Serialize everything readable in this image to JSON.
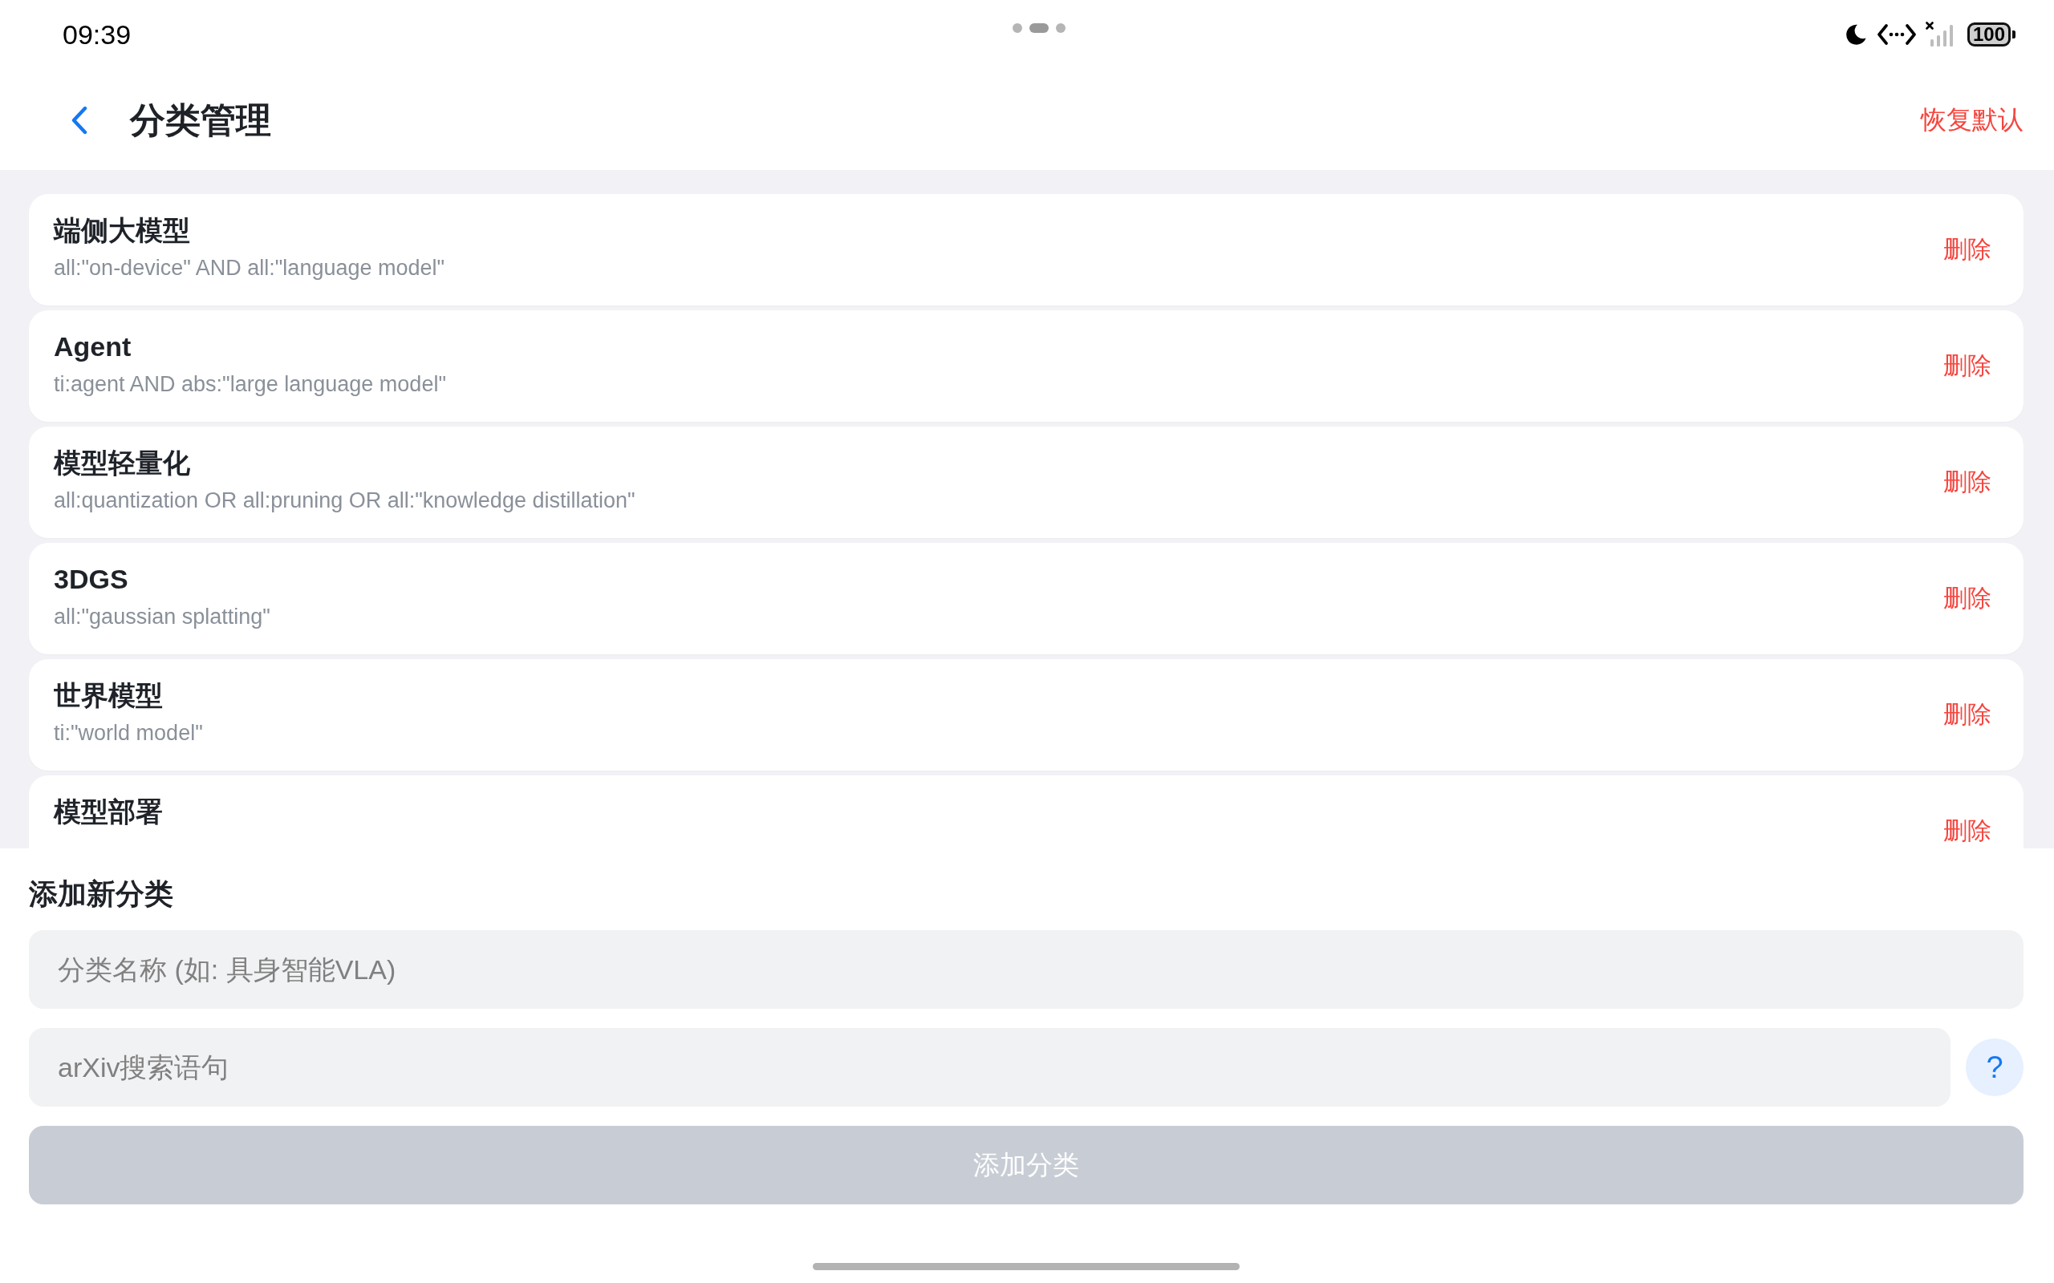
{
  "status_bar": {
    "time": "09:39",
    "battery": "100"
  },
  "header": {
    "title": "分类管理",
    "action": "恢复默认"
  },
  "categories": [
    {
      "name": "端侧大模型",
      "query": "all:\"on-device\" AND all:\"language model\"",
      "action": "删除"
    },
    {
      "name": "Agent",
      "query": "ti:agent AND abs:\"large language model\"",
      "action": "删除"
    },
    {
      "name": "模型轻量化",
      "query": "all:quantization OR all:pruning OR all:\"knowledge distillation\"",
      "action": "删除"
    },
    {
      "name": "3DGS",
      "query": "all:\"gaussian splatting\"",
      "action": "删除"
    },
    {
      "name": "世界模型",
      "query": "ti:\"world model\"",
      "action": "删除"
    },
    {
      "name": "模型部署",
      "action": "删除"
    }
  ],
  "add_form": {
    "heading": "添加新分类",
    "name_field": {
      "placeholder": "分类名称 (如: 具身智能VLA)"
    },
    "query_field": {
      "placeholder": "arXiv搜索语句"
    },
    "help_button": "?",
    "submit_button": {
      "label": "添加分类",
      "disabled": true
    }
  }
}
